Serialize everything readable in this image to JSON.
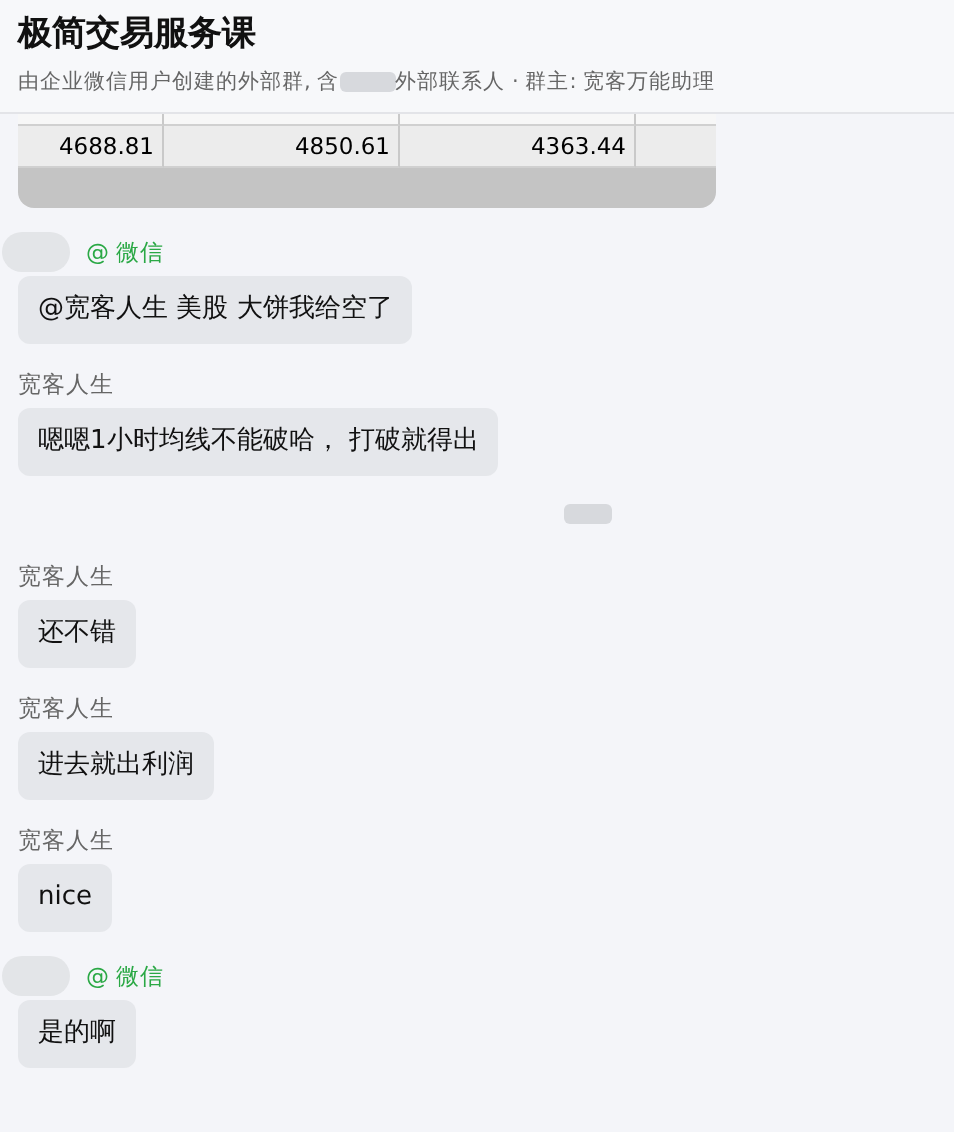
{
  "header": {
    "title": "极简交易服务课",
    "subtitle_before": "由企业微信用户创建的外部群, 含",
    "subtitle_after": "外部联系人 · 群主: 宽客万能助理"
  },
  "table_image": {
    "cells": [
      "4688.81",
      "4850.61",
      "4363.44"
    ]
  },
  "messages": [
    {
      "kind": "message",
      "sender_tag": "@ 微信",
      "text": "@宽客人生 美股 大饼我给空了"
    },
    {
      "kind": "message",
      "sender": "宽客人生",
      "text": "嗯嗯1小时均线不能破哈， 打破就得出"
    },
    {
      "kind": "hidden-notice"
    },
    {
      "kind": "message",
      "sender": "宽客人生",
      "text": "还不错"
    },
    {
      "kind": "message",
      "sender": "宽客人生",
      "text": "进去就出利润"
    },
    {
      "kind": "message",
      "sender": "宽客人生",
      "text": "nice"
    },
    {
      "kind": "message",
      "sender_tag": "@ 微信",
      "text": "是的啊"
    }
  ]
}
